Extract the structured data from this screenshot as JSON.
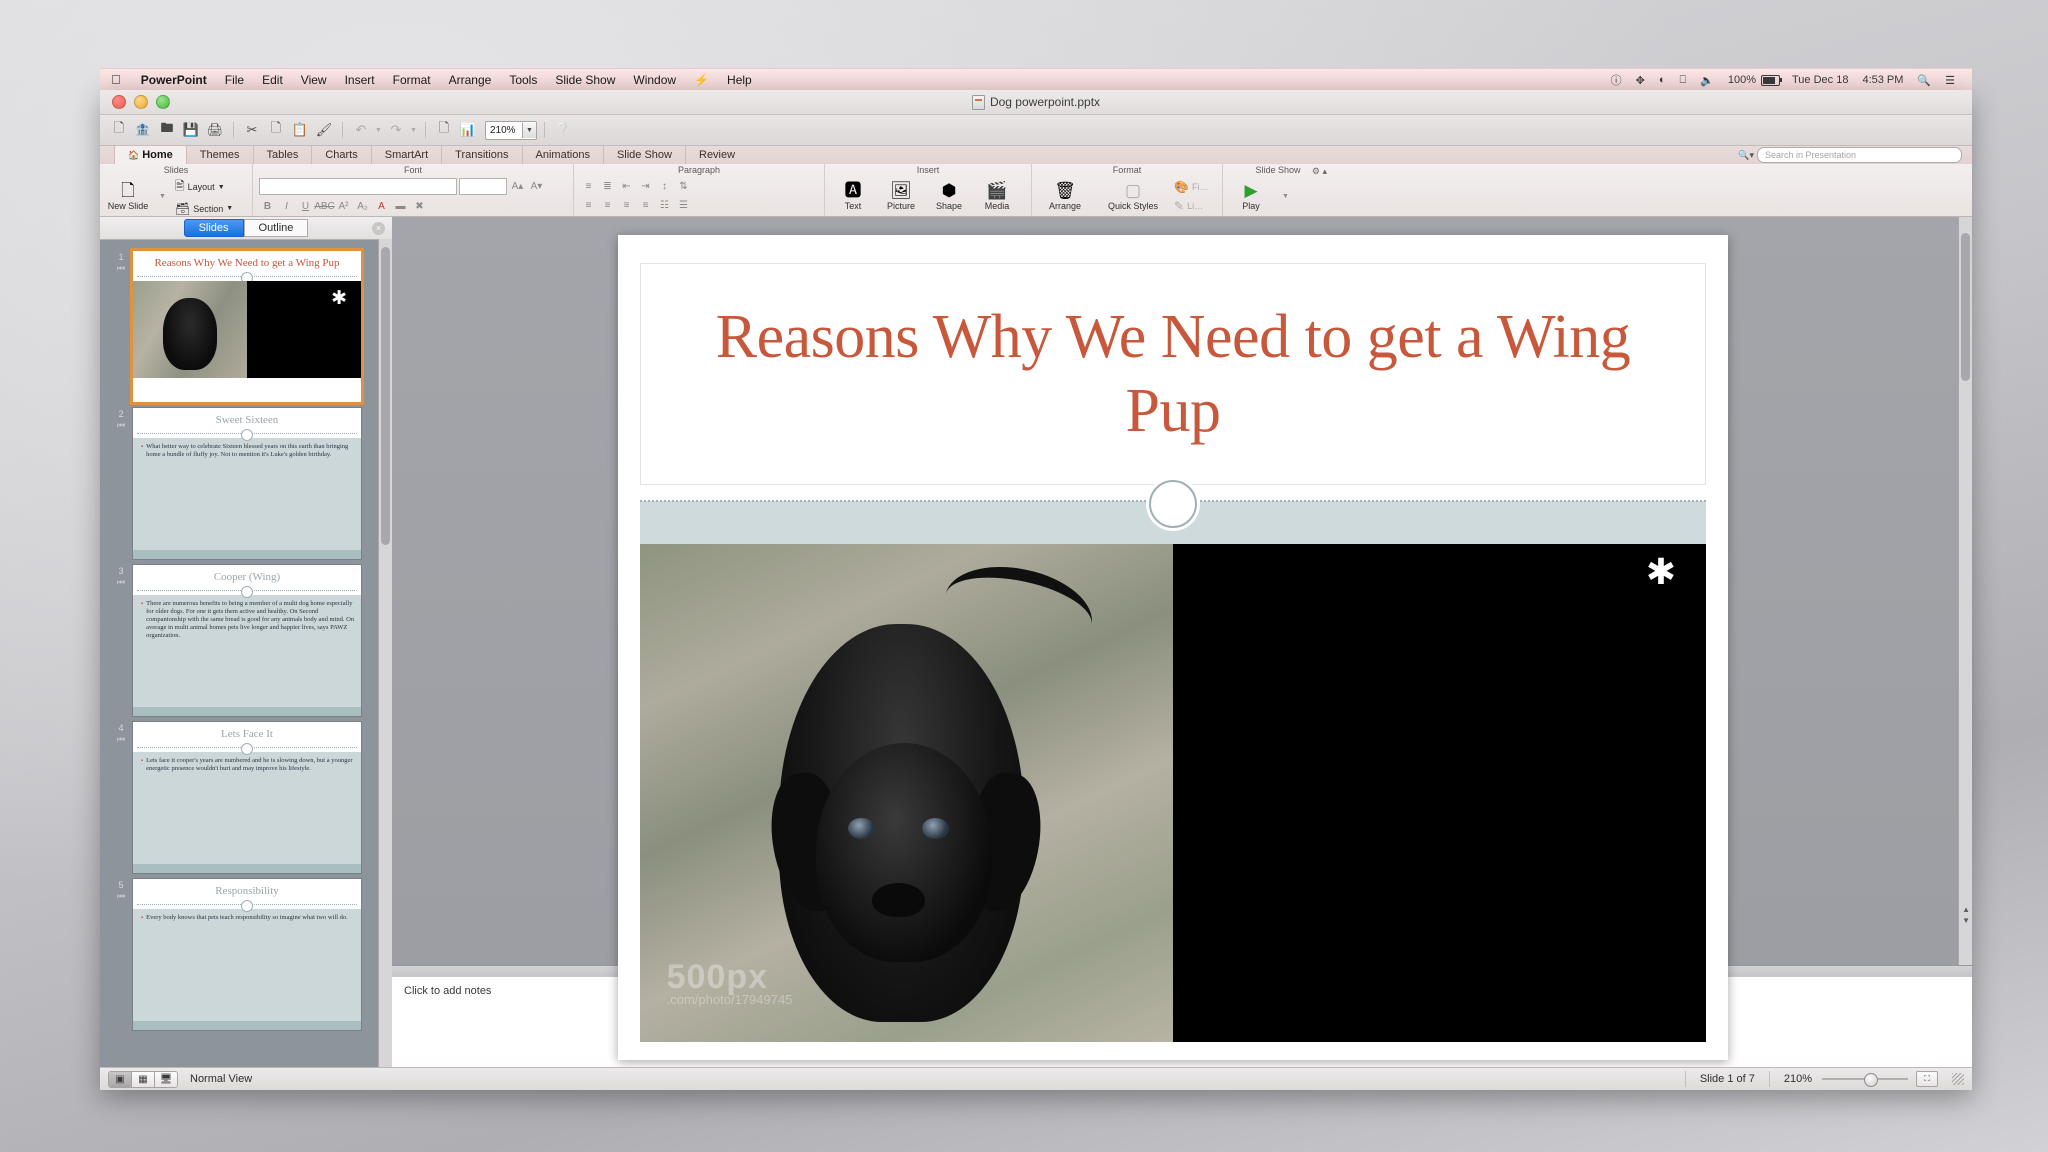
{
  "menubar": {
    "apple_icon": "apple-icon",
    "items": [
      "PowerPoint",
      "File",
      "Edit",
      "View",
      "Insert",
      "Format",
      "Arrange",
      "Tools",
      "Slide Show",
      "Window",
      "Help"
    ],
    "app_name": "PowerPoint",
    "right": {
      "battery_percent": "100%",
      "date": "Tue Dec 18",
      "time": "4:53 PM",
      "icons": [
        "vpn-icon",
        "bluetooth-icon",
        "wifi-icon",
        "airplay-icon",
        "volume-icon",
        "battery-icon",
        "spotlight-search-icon",
        "notification-center-icon"
      ]
    }
  },
  "window": {
    "title": "Dog powerpoint.pptx",
    "traffic_lights": [
      "close-button",
      "minimize-button",
      "zoom-button"
    ]
  },
  "toolbar": {
    "zoom_value": "210%",
    "buttons": [
      "new-icon",
      "open-icon",
      "save-as-icon",
      "save-icon",
      "print-icon",
      "cut-icon",
      "copy-icon",
      "paste-icon",
      "format-painter-icon",
      "undo-icon",
      "redo-icon",
      "new-slide-icon",
      "smart-art-icon",
      "help-icon"
    ]
  },
  "ribbon": {
    "tabs": [
      "Home",
      "Themes",
      "Tables",
      "Charts",
      "SmartArt",
      "Transitions",
      "Animations",
      "Slide Show",
      "Review"
    ],
    "active_tab": "Home",
    "search_placeholder": "Search in Presentation",
    "groups": [
      {
        "label": "Slides",
        "items": [
          "New Slide",
          "Layout",
          "Section"
        ]
      },
      {
        "label": "Font",
        "items": [
          "B",
          "I",
          "U",
          "ABC",
          "A²",
          "A₂"
        ]
      },
      {
        "label": "Paragraph",
        "items": []
      },
      {
        "label": "Insert",
        "items": [
          "Text",
          "Picture",
          "Shape",
          "Media"
        ]
      },
      {
        "label": "Format",
        "items": [
          "Arrange",
          "Quick Styles"
        ]
      },
      {
        "label": "Slide Show",
        "items": [
          "Play"
        ]
      }
    ],
    "new_slide_label": "New Slide",
    "layout_label": "Layout",
    "section_label": "Section",
    "insert_items": [
      {
        "label": "Text",
        "icon": "text-box-icon"
      },
      {
        "label": "Picture",
        "icon": "picture-icon"
      },
      {
        "label": "Shape",
        "icon": "shape-icon"
      },
      {
        "label": "Media",
        "icon": "media-icon"
      }
    ],
    "format_items": [
      {
        "label": "Arrange",
        "icon": "arrange-icon"
      },
      {
        "label": "Quick Styles",
        "icon": "quick-styles-icon"
      }
    ],
    "slideshow_items": [
      {
        "label": "Play",
        "icon": "play-icon"
      }
    ]
  },
  "slide_pane": {
    "tabs": [
      "Slides",
      "Outline"
    ],
    "active_tab": "Slides",
    "close_label": "×",
    "thumbnails": [
      {
        "number": "1",
        "title": "Reasons Why We Need to get a Wing Pup",
        "body": "",
        "type": "title-slide",
        "selected": true
      },
      {
        "number": "2",
        "title": "Sweet Sixteen",
        "body": "What better way to celebrate Sixteen blessed years on this earth than bringing home a bundle of fluffy joy.  Not to mention it's Luke's golden birthday.",
        "type": "content-slide",
        "selected": false
      },
      {
        "number": "3",
        "title": "Cooper (Wing)",
        "body": "There are numerous benefits to being a member of a multi dog home especially for older dogs.  For one it gets them active and healthy.  On Second companionship with the same bread is good for any animals body and mind.  On average in multi animal homes pets live longer and happier lives, says PAWZ organization.",
        "type": "content-slide",
        "selected": false
      },
      {
        "number": "4",
        "title": "Lets Face It",
        "body": "Lets face it cooper's years are numbered and he is slowing down, but a younger energetic presence wouldn't hurt and may improve his lifestyle.",
        "type": "content-slide",
        "selected": false
      },
      {
        "number": "5",
        "title": "Responsibility",
        "body": "Every body knows that pets teach responsibility so imagine what two will do.",
        "type": "content-slide",
        "selected": false
      }
    ]
  },
  "slide": {
    "title": "Reasons Why We Need to get a Wing Pup",
    "title_color": "#c8583b",
    "band_color": "#cfdadd",
    "photo_watermark_big": "500px",
    "photo_watermark_small": ".com/photo/17949745",
    "star_placeholder": "✱"
  },
  "notes": {
    "placeholder": "Click to add notes",
    "split_dots": "• • •"
  },
  "statusbar": {
    "view_buttons": [
      "normal-view-icon",
      "slide-sorter-icon",
      "slideshow-view-icon"
    ],
    "view_label": "Normal View",
    "slide_counter": "Slide 1 of 7",
    "zoom_level": "210%",
    "fit_label": "fit-to-window-icon"
  }
}
